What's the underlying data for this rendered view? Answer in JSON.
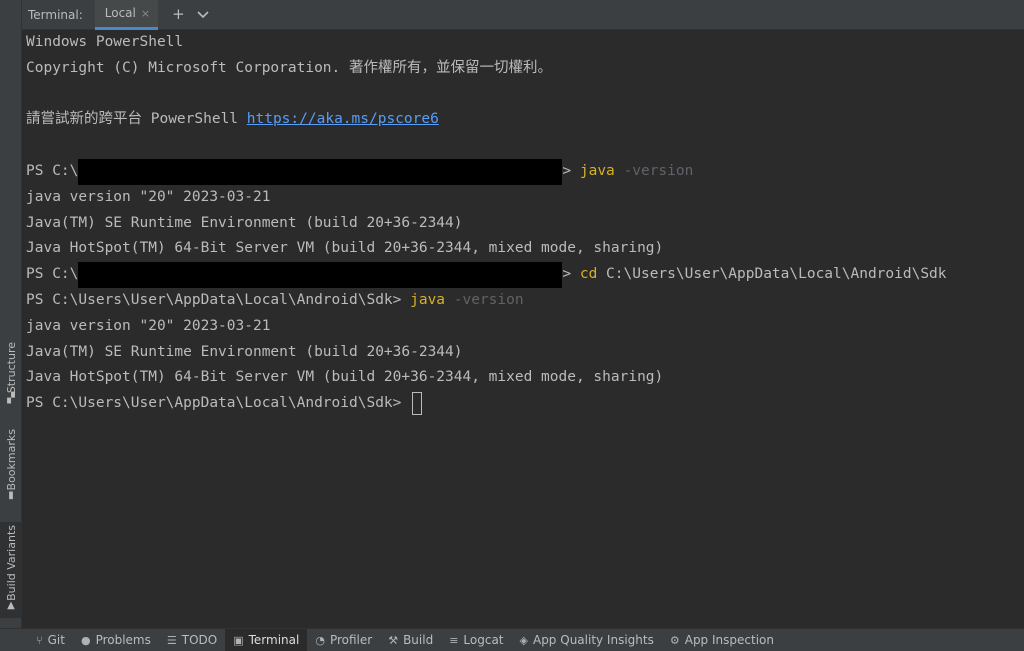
{
  "tabbar": {
    "title": "Terminal:",
    "tab_label": "Local",
    "close_glyph": "×",
    "add_glyph": "+",
    "dropdown_glyph": "⌄"
  },
  "side_tabs": {
    "structure": "Structure",
    "bookmarks": "Bookmarks",
    "build_variants": "Build Variants"
  },
  "terminal": {
    "l1": "Windows PowerShell",
    "l2": "Copyright (C) Microsoft Corporation. 著作權所有，並保留一切權利。",
    "l4_text": "請嘗試新的跨平台 PowerShell ",
    "l4_link": "https://aka.ms/pscore6",
    "prompt_prefix": "PS C:\\",
    "prompt_suffix": "> ",
    "cmd_java": "java",
    "flag_version": " -version",
    "java_version": "java version \"20\" 2023-03-21",
    "runtime": "Java(TM) SE Runtime Environment (build 20+36-2344)",
    "hotspot": "Java HotSpot(TM) 64-Bit Server VM (build 20+36-2344, mixed mode, sharing)",
    "cmd_cd": "cd",
    "cd_path": " C:\\Users\\User\\AppData\\Local\\Android\\Sdk",
    "sdk_prompt": "PS C:\\Users\\User\\AppData\\Local\\Android\\Sdk> "
  },
  "bottombar": {
    "git": "Git",
    "problems": "Problems",
    "todo": "TODO",
    "terminal": "Terminal",
    "profiler": "Profiler",
    "build": "Build",
    "logcat": "Logcat",
    "aqi": "App Quality Insights",
    "app_inspection": "App Inspection"
  },
  "colors": {
    "background": "#2b2b2b",
    "command": "#d4b126",
    "flag": "#5f6367",
    "link": "#589df6",
    "accent": "#4a88c7"
  }
}
